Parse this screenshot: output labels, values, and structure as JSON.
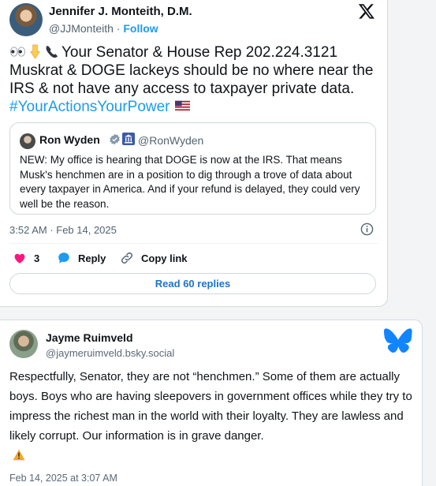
{
  "x_post": {
    "author_name": "Jennifer J. Monteith, D.M.",
    "handle": "@JJMonteith",
    "separator": " · ",
    "follow_label": "Follow",
    "body_text": "Your Senator & House Rep 202.224.3121 Muskrat & DOGE lackeys should be no where near the IRS & not have any access to taxpayer private data.",
    "hashtag": "#YourActionsYourPower",
    "emoji": [
      "eyes",
      "point-down",
      "telephone",
      "us-flag"
    ],
    "quote": {
      "author_name": "Ron Wyden",
      "handle": "@RonWyden",
      "text": "NEW: My office is hearing that DOGE is now at the IRS. That means Musk's henchmen are in a position to dig through a trove of data about every taxpayer in America. And if your refund is delayed, they could very well be the reason."
    },
    "timestamp": "3:52 AM · Feb 14, 2025",
    "like_count": "3",
    "reply_label": "Reply",
    "copy_link_label": "Copy link",
    "read_replies_label": "Read 60 replies"
  },
  "bluesky_post": {
    "author_name": "Jayme Ruimveld",
    "handle": "@jaymeruimveld.bsky.social",
    "text": "Respectfully, Senator, they are not “henchmen.” Some of them are actually boys. Boys who are having sleepovers in government offices while they try to impress the richest man in the world with their loyalty. They are lawless and likely corrupt. Our information is in grave danger.",
    "timestamp": "Feb 14, 2025 at 3:07 AM"
  },
  "colors": {
    "x_link": "#1d9bf0",
    "like": "#f91880",
    "bluesky": "#1185fe",
    "warning": "#f5a623"
  }
}
